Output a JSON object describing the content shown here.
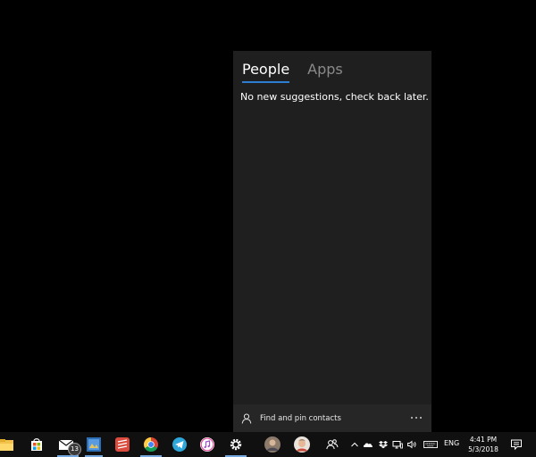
{
  "people_flyout": {
    "tabs": [
      {
        "label": "People",
        "active": true
      },
      {
        "label": "Apps",
        "active": false
      }
    ],
    "empty_message": "No new suggestions, check back later.",
    "footer": {
      "find_label": "Find and pin contacts",
      "find_icon": "person-icon",
      "more_icon": "more-dots-icon"
    }
  },
  "taskbar": {
    "pinned_apps": [
      {
        "name": "file-explorer-icon"
      },
      {
        "name": "store-icon"
      },
      {
        "name": "mail-icon",
        "badge": "13"
      },
      {
        "name": "photo-app-icon"
      },
      {
        "name": "todoist-icon"
      },
      {
        "name": "chrome-icon"
      },
      {
        "name": "telegram-icon"
      },
      {
        "name": "itunes-icon"
      },
      {
        "name": "settings-icon"
      },
      {
        "name": "contact-avatar-1"
      },
      {
        "name": "contact-avatar-2"
      },
      {
        "name": "people-icon"
      }
    ],
    "tray": {
      "language": "ENG",
      "time": "4:41 PM",
      "date": "5/3/2018"
    }
  },
  "colors": {
    "flyout_bg": "#1f1f1f",
    "accent": "#2d7dd2",
    "taskbar_bg": "#101010"
  }
}
